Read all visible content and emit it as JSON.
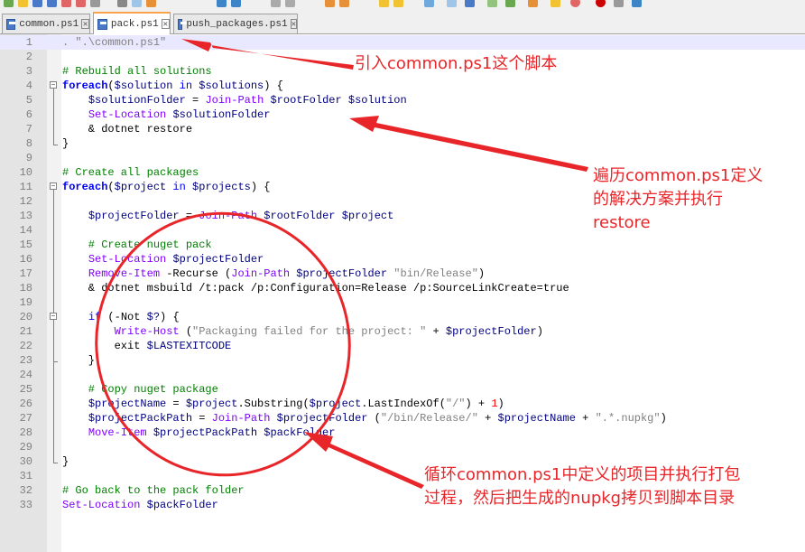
{
  "tabs": [
    {
      "label": "common.ps1",
      "active": false
    },
    {
      "label": "pack.ps1",
      "active": true
    },
    {
      "label": "push_packages.ps1",
      "active": false
    }
  ],
  "code_lines": [
    {
      "n": "1",
      "segs": [
        {
          "t": ". \".\\common.ps1\"",
          "c": "#808080"
        }
      ]
    },
    {
      "n": "2",
      "segs": []
    },
    {
      "n": "3",
      "segs": [
        {
          "t": "# Rebuild all solutions",
          "c": "#008000"
        }
      ]
    },
    {
      "n": "4",
      "segs": [
        {
          "t": "foreach",
          "c": "#0000ff",
          "b": true
        },
        {
          "t": "(",
          "c": "#000"
        },
        {
          "t": "$solution",
          "c": "#000080"
        },
        {
          "t": " in ",
          "c": "#0000ff"
        },
        {
          "t": "$solutions",
          "c": "#000080"
        },
        {
          "t": ") {",
          "c": "#000"
        }
      ]
    },
    {
      "n": "5",
      "segs": [
        {
          "t": "    ",
          "c": "#000"
        },
        {
          "t": "$solutionFolder",
          "c": "#000080"
        },
        {
          "t": " = ",
          "c": "#000"
        },
        {
          "t": "Join-Path",
          "c": "#8000ff"
        },
        {
          "t": " ",
          "c": "#000"
        },
        {
          "t": "$rootFolder",
          "c": "#000080"
        },
        {
          "t": " ",
          "c": "#000"
        },
        {
          "t": "$solution",
          "c": "#000080"
        }
      ]
    },
    {
      "n": "6",
      "segs": [
        {
          "t": "    ",
          "c": "#000"
        },
        {
          "t": "Set-Location",
          "c": "#8000ff"
        },
        {
          "t": " ",
          "c": "#000"
        },
        {
          "t": "$solutionFolder",
          "c": "#000080"
        }
      ]
    },
    {
      "n": "7",
      "segs": [
        {
          "t": "    & dotnet restore",
          "c": "#000"
        }
      ]
    },
    {
      "n": "8",
      "segs": [
        {
          "t": "}",
          "c": "#000"
        }
      ]
    },
    {
      "n": "9",
      "segs": []
    },
    {
      "n": "10",
      "segs": [
        {
          "t": "# Create all packages",
          "c": "#008000"
        }
      ]
    },
    {
      "n": "11",
      "segs": [
        {
          "t": "foreach",
          "c": "#0000ff",
          "b": true
        },
        {
          "t": "(",
          "c": "#000"
        },
        {
          "t": "$project",
          "c": "#000080"
        },
        {
          "t": " in ",
          "c": "#0000ff"
        },
        {
          "t": "$projects",
          "c": "#000080"
        },
        {
          "t": ") {",
          "c": "#000"
        }
      ]
    },
    {
      "n": "12",
      "segs": []
    },
    {
      "n": "13",
      "segs": [
        {
          "t": "    ",
          "c": "#000"
        },
        {
          "t": "$projectFolder",
          "c": "#000080"
        },
        {
          "t": " = ",
          "c": "#000"
        },
        {
          "t": "Join-Path",
          "c": "#8000ff"
        },
        {
          "t": " ",
          "c": "#000"
        },
        {
          "t": "$rootFolder",
          "c": "#000080"
        },
        {
          "t": " ",
          "c": "#000"
        },
        {
          "t": "$project",
          "c": "#000080"
        }
      ]
    },
    {
      "n": "14",
      "segs": []
    },
    {
      "n": "15",
      "segs": [
        {
          "t": "    # Create nuget pack",
          "c": "#008000"
        }
      ]
    },
    {
      "n": "16",
      "segs": [
        {
          "t": "    ",
          "c": "#000"
        },
        {
          "t": "Set-Location",
          "c": "#8000ff"
        },
        {
          "t": " ",
          "c": "#000"
        },
        {
          "t": "$projectFolder",
          "c": "#000080"
        }
      ]
    },
    {
      "n": "17",
      "segs": [
        {
          "t": "    ",
          "c": "#000"
        },
        {
          "t": "Remove-Item",
          "c": "#8000ff"
        },
        {
          "t": " -Recurse (",
          "c": "#000"
        },
        {
          "t": "Join-Path",
          "c": "#8000ff"
        },
        {
          "t": " ",
          "c": "#000"
        },
        {
          "t": "$projectFolder",
          "c": "#000080"
        },
        {
          "t": " ",
          "c": "#000"
        },
        {
          "t": "\"bin/Release\"",
          "c": "#808080"
        },
        {
          "t": ")",
          "c": "#000"
        }
      ]
    },
    {
      "n": "18",
      "segs": [
        {
          "t": "    & dotnet msbuild /t:pack /p:Configuration=Release /p:SourceLinkCreate=true",
          "c": "#000"
        }
      ]
    },
    {
      "n": "19",
      "segs": []
    },
    {
      "n": "20",
      "segs": [
        {
          "t": "    ",
          "c": "#000"
        },
        {
          "t": "if",
          "c": "#0000ff"
        },
        {
          "t": " (-Not ",
          "c": "#000"
        },
        {
          "t": "$?",
          "c": "#000080"
        },
        {
          "t": ") {",
          "c": "#000"
        }
      ]
    },
    {
      "n": "21",
      "segs": [
        {
          "t": "        ",
          "c": "#000"
        },
        {
          "t": "Write-Host",
          "c": "#8000ff"
        },
        {
          "t": " (",
          "c": "#000"
        },
        {
          "t": "\"Packaging failed for the project: \"",
          "c": "#808080"
        },
        {
          "t": " + ",
          "c": "#000"
        },
        {
          "t": "$projectFolder",
          "c": "#000080"
        },
        {
          "t": ")",
          "c": "#000"
        }
      ]
    },
    {
      "n": "22",
      "segs": [
        {
          "t": "        exit ",
          "c": "#000"
        },
        {
          "t": "$LASTEXITCODE",
          "c": "#000080"
        }
      ]
    },
    {
      "n": "23",
      "segs": [
        {
          "t": "    }",
          "c": "#000"
        }
      ]
    },
    {
      "n": "24",
      "segs": []
    },
    {
      "n": "25",
      "segs": [
        {
          "t": "    # Copy nuget package",
          "c": "#008000"
        }
      ]
    },
    {
      "n": "26",
      "segs": [
        {
          "t": "    ",
          "c": "#000"
        },
        {
          "t": "$projectName",
          "c": "#000080"
        },
        {
          "t": " = ",
          "c": "#000"
        },
        {
          "t": "$project",
          "c": "#000080"
        },
        {
          "t": ".Substring(",
          "c": "#000"
        },
        {
          "t": "$project",
          "c": "#000080"
        },
        {
          "t": ".LastIndexOf(",
          "c": "#000"
        },
        {
          "t": "\"/\"",
          "c": "#808080"
        },
        {
          "t": ") + ",
          "c": "#000"
        },
        {
          "t": "1",
          "c": "#ff0000"
        },
        {
          "t": ")",
          "c": "#000"
        }
      ]
    },
    {
      "n": "27",
      "segs": [
        {
          "t": "    ",
          "c": "#000"
        },
        {
          "t": "$projectPackPath",
          "c": "#000080"
        },
        {
          "t": " = ",
          "c": "#000"
        },
        {
          "t": "Join-Path",
          "c": "#8000ff"
        },
        {
          "t": " ",
          "c": "#000"
        },
        {
          "t": "$projectFolder",
          "c": "#000080"
        },
        {
          "t": " (",
          "c": "#000"
        },
        {
          "t": "\"/bin/Release/\"",
          "c": "#808080"
        },
        {
          "t": " + ",
          "c": "#000"
        },
        {
          "t": "$projectName",
          "c": "#000080"
        },
        {
          "t": " + ",
          "c": "#000"
        },
        {
          "t": "\".*.nupkg\"",
          "c": "#808080"
        },
        {
          "t": ")",
          "c": "#000"
        }
      ]
    },
    {
      "n": "28",
      "segs": [
        {
          "t": "    ",
          "c": "#000"
        },
        {
          "t": "Move-Item",
          "c": "#8000ff"
        },
        {
          "t": " ",
          "c": "#000"
        },
        {
          "t": "$projectPackPath",
          "c": "#000080"
        },
        {
          "t": " ",
          "c": "#000"
        },
        {
          "t": "$packFolder",
          "c": "#000080"
        }
      ]
    },
    {
      "n": "29",
      "segs": []
    },
    {
      "n": "30",
      "segs": [
        {
          "t": "}",
          "c": "#000"
        }
      ]
    },
    {
      "n": "31",
      "segs": []
    },
    {
      "n": "32",
      "segs": [
        {
          "t": "# Go back to the pack folder",
          "c": "#008000"
        }
      ]
    },
    {
      "n": "33",
      "segs": [
        {
          "t": "Set-Location",
          "c": "#8000ff"
        },
        {
          "t": " ",
          "c": "#000"
        },
        {
          "t": "$packFolder",
          "c": "#000080"
        }
      ]
    }
  ],
  "annotations": {
    "note1": "引入common.ps1这个脚本",
    "note2_line1": "遍历common.ps1定义",
    "note2_line2": "的解决方案并执行",
    "note2_line3": "restore",
    "note3_line1": "循环common.ps1中定义的项目并执行打包",
    "note3_line2": "过程，然后把生成的nupkg拷贝到脚本目录"
  },
  "colors": {
    "annotation": "#e8262a",
    "active_tab_accent": "#f9a44c"
  }
}
